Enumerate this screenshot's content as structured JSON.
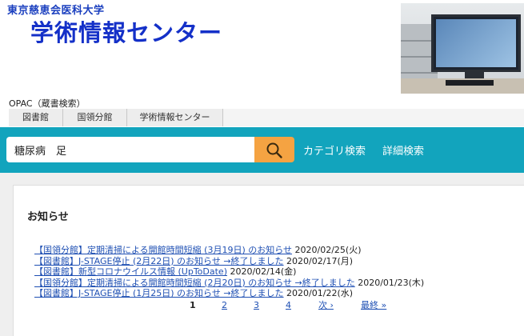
{
  "header": {
    "university_name": "東京慈恵会医科大学",
    "center_title": "学術情報センター",
    "opac_label": "OPAC（蔵書検索）"
  },
  "tabs": [
    {
      "label": "図書館"
    },
    {
      "label": "国領分館"
    },
    {
      "label": "学術情報センター"
    }
  ],
  "search": {
    "value": "糖尿病　足",
    "placeholder": "",
    "button_icon": "search-icon"
  },
  "nav": {
    "category_search": "カテゴリ検索",
    "advanced_search": "詳細検索"
  },
  "notices": {
    "title": "お知らせ",
    "items": [
      {
        "text": "【国領分館】定期清掃による開館時間短縮 (3月19日) のお知らせ",
        "date": "2020/02/25(火)"
      },
      {
        "text": "【図書館】J-STAGE停止 (2月22日) のお知らせ →終了しました",
        "date": "2020/02/17(月)"
      },
      {
        "text": "【図書館】新型コロナウイルス情報 (UpToDate)",
        "date": "2020/02/14(金)"
      },
      {
        "text": "【国領分館】定期清掃による開館時間短縮 (2月20日) のお知らせ →終了しました",
        "date": "2020/01/23(木)"
      },
      {
        "text": "【図書館】J-STAGE停止 (1月25日) のお知らせ →終了しました",
        "date": "2020/01/22(水)"
      }
    ]
  },
  "pagination": {
    "current": "1",
    "pages": [
      "2",
      "3",
      "4"
    ],
    "next": "次 ›",
    "last": "最終 »"
  },
  "colors": {
    "search_bar": "#12a4bd",
    "search_button": "#f5a342",
    "link": "#1e4fb3",
    "title_blue": "#1430c8"
  }
}
